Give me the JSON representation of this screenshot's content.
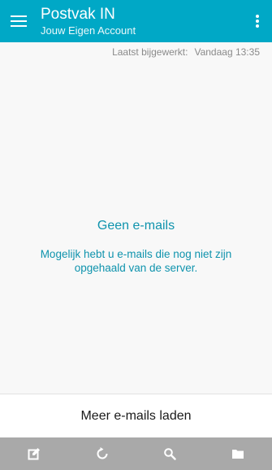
{
  "header": {
    "title": "Postvak IN",
    "subtitle": "Jouw Eigen Account",
    "menu_icon": "hamburger-menu-icon",
    "more_icon": "more-vertical-icon",
    "accent_color": "#00a8c6"
  },
  "status": {
    "last_updated_label": "Laatst bijgewerkt:",
    "last_updated_value": "Vandaag 13:35"
  },
  "empty_state": {
    "title": "Geen e-mails",
    "message": "Mogelijk hebt u e-mails die nog niet zijn opgehaald van de server.",
    "color": "#0f93ad"
  },
  "load_more": {
    "label": "Meer e-mails laden"
  },
  "bottom_bar": {
    "items": [
      {
        "icon": "compose-icon"
      },
      {
        "icon": "refresh-icon"
      },
      {
        "icon": "search-icon"
      },
      {
        "icon": "folder-icon"
      }
    ],
    "background": "#a9a9a9"
  }
}
